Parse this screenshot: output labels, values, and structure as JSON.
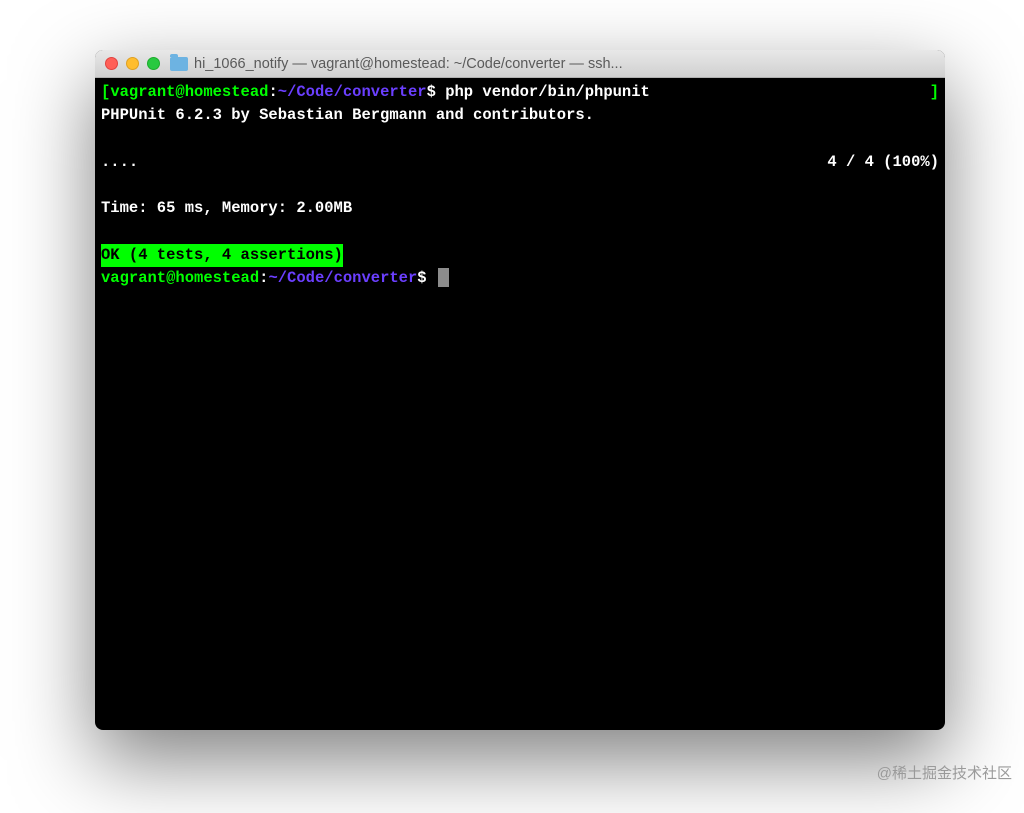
{
  "window": {
    "title": "hi_1066_notify — vagrant@homestead: ~/Code/converter — ssh..."
  },
  "prompt1": {
    "open_bracket": "[",
    "user_host": "vagrant@homestead",
    "colon": ":",
    "path": "~/Code/converter",
    "dollar": "$",
    "command": " php vendor/bin/phpunit",
    "close_bracket": "]"
  },
  "output": {
    "version_line": "PHPUnit 6.2.3 by Sebastian Bergmann and contributors.",
    "dots": "....",
    "progress": "4 / 4 (100%)",
    "time_mem": "Time: 65 ms, Memory: 2.00MB",
    "ok_line": "OK (4 tests, 4 assertions)"
  },
  "prompt2": {
    "user_host": "vagrant@homestead",
    "colon": ":",
    "path": "~/Code/converter",
    "dollar": "$"
  },
  "watermark": "@稀土掘金技术社区"
}
